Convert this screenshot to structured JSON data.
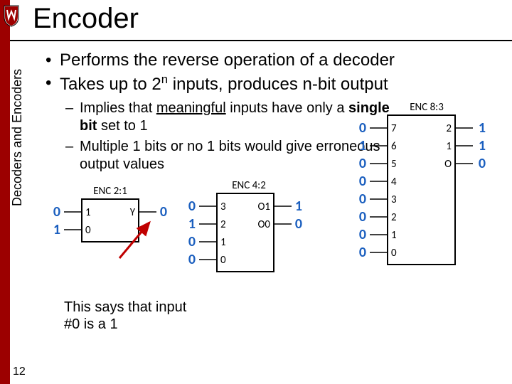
{
  "title": "Encoder",
  "side_label": "Decoders and Encoders",
  "page_number": "12",
  "bullets": {
    "b1": "Performs the reverse operation of a decoder",
    "b2_pre": "Takes up to 2",
    "b2_sup": "n",
    "b2_post": " inputs, produces n-bit output",
    "s1_pre": "Implies that ",
    "s1_u": "meaningful",
    "s1_mid": " inputs have only a ",
    "s1_b": "single bit",
    "s1_post": " set to 1",
    "s2": "Multiple 1 bits or no 1 bits would give erroneous output values"
  },
  "caption": "This says that input #0 is a 1",
  "enc21": {
    "label": "ENC 2:1",
    "in_pins": [
      "1",
      "0"
    ],
    "out_pins": [
      "Y"
    ],
    "in_vals": [
      "0",
      "1"
    ],
    "out_vals": [
      "0"
    ]
  },
  "enc42": {
    "label": "ENC 4:2",
    "in_pins": [
      "3",
      "2",
      "1",
      "0"
    ],
    "out_pins": [
      "O1",
      "O0"
    ],
    "in_vals": [
      "0",
      "1",
      "0",
      "0"
    ],
    "out_vals": [
      "1",
      "0"
    ]
  },
  "enc83": {
    "label": "ENC 8:3",
    "in_pins": [
      "7",
      "6",
      "5",
      "4",
      "3",
      "2",
      "1",
      "0"
    ],
    "out_pins": [
      "2",
      "1",
      "O"
    ],
    "in_vals": [
      "0",
      "1",
      "0",
      "0",
      "0",
      "0",
      "0",
      "0"
    ],
    "out_vals": [
      "1",
      "1",
      "0"
    ]
  }
}
